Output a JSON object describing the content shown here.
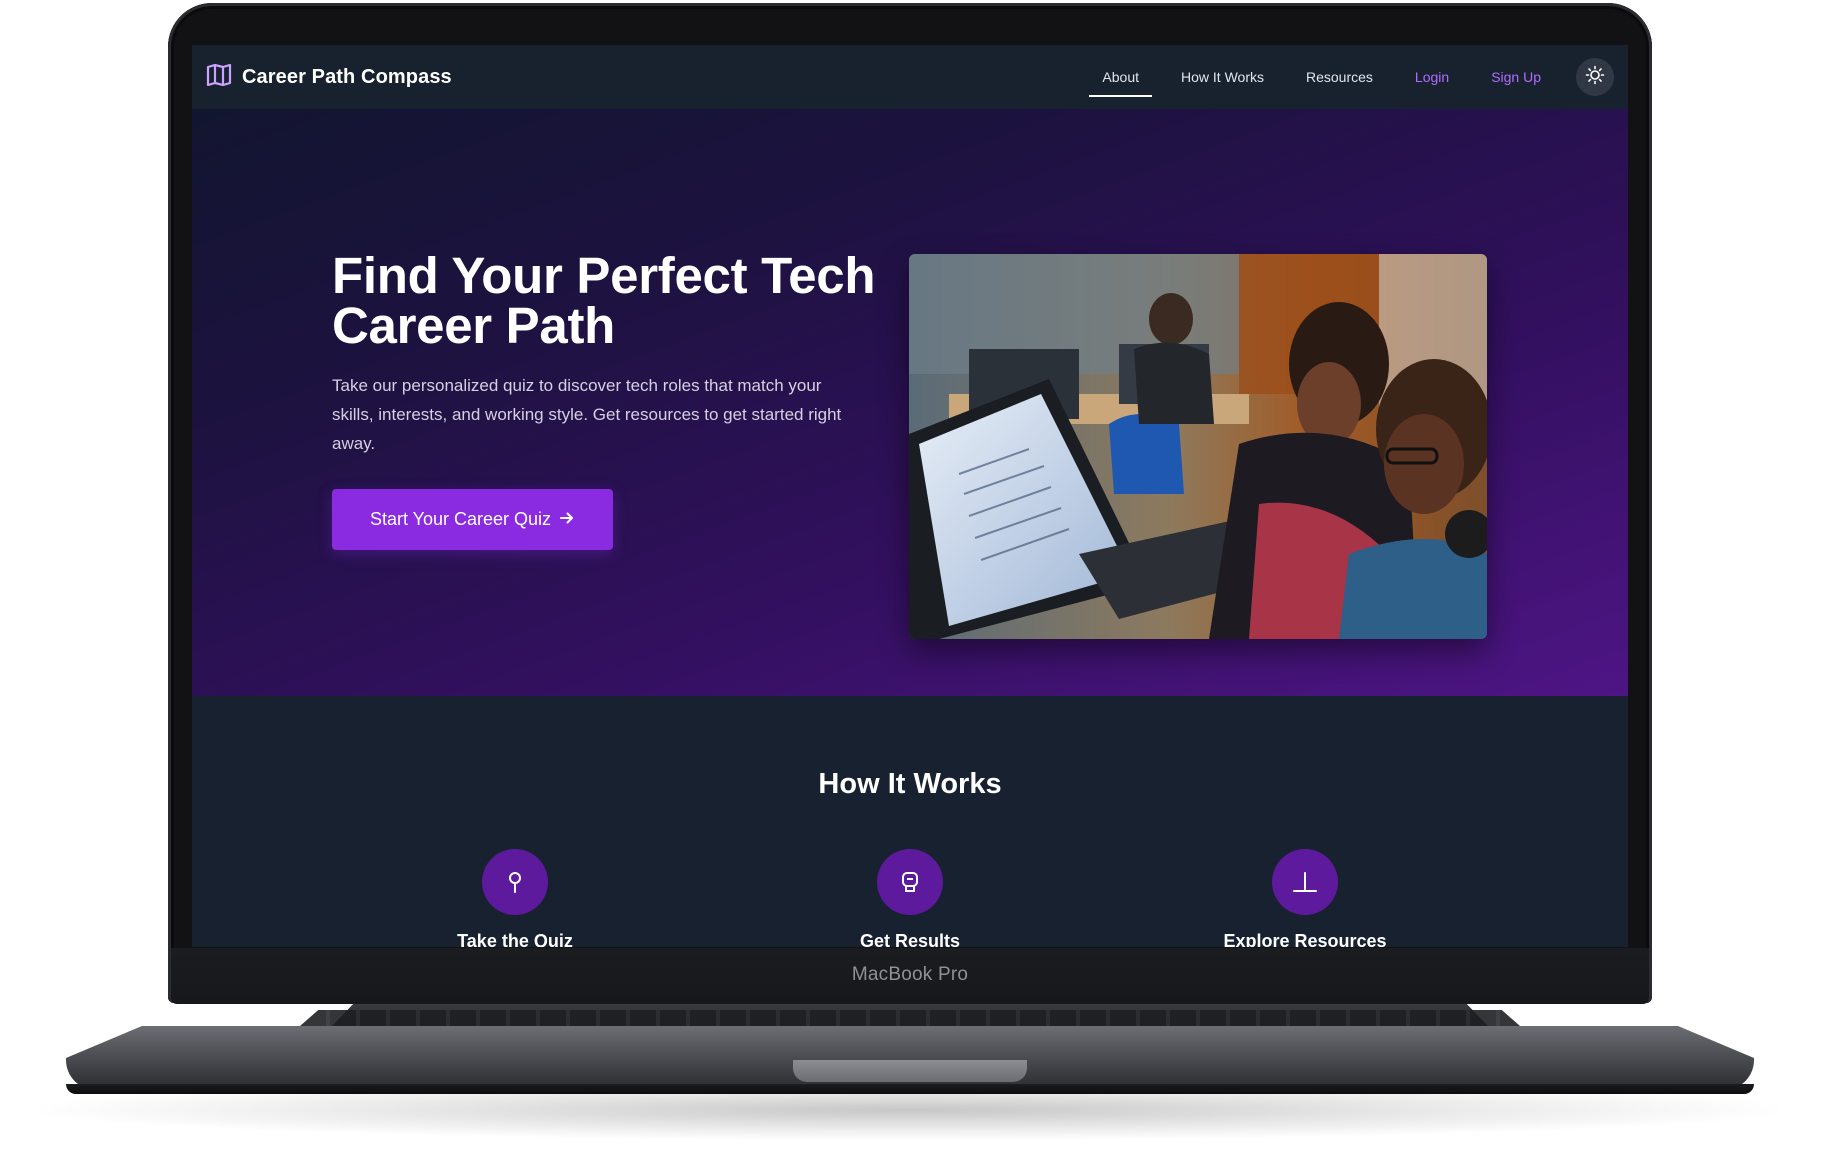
{
  "device": {
    "label": "MacBook Pro"
  },
  "navbar": {
    "brand": "Career Path Compass",
    "links": [
      {
        "label": "About",
        "active": true
      },
      {
        "label": "How It Works",
        "active": false
      },
      {
        "label": "Resources",
        "active": false
      },
      {
        "label": "Login",
        "active": false
      },
      {
        "label": "Sign Up",
        "active": false
      }
    ],
    "theme_toggle_icon": "sun-icon"
  },
  "hero": {
    "title": "Find Your Perfect Tech Career Path",
    "subtitle": "Take our personalized quiz to discover tech roles that match your skills, interests, and working style. Get resources to get started right away.",
    "cta_label": "Start Your Career Quiz",
    "cta_icon": "arrow-right-icon",
    "image_icon": "photo-people-at-computers"
  },
  "how_it_works": {
    "title": "How It Works",
    "steps": [
      {
        "title": "Take the Quiz",
        "icon": "map-pin-icon"
      },
      {
        "title": "Get Results",
        "icon": "badge-icon"
      },
      {
        "title": "Explore Resources",
        "icon": "anchor-icon"
      }
    ]
  },
  "colors": {
    "accent": "#8a2be2",
    "link_accent": "#b16cff",
    "nav_bg": "#18222f",
    "section_bg": "#172130",
    "step_icon_bg": "#5e1a9c"
  }
}
